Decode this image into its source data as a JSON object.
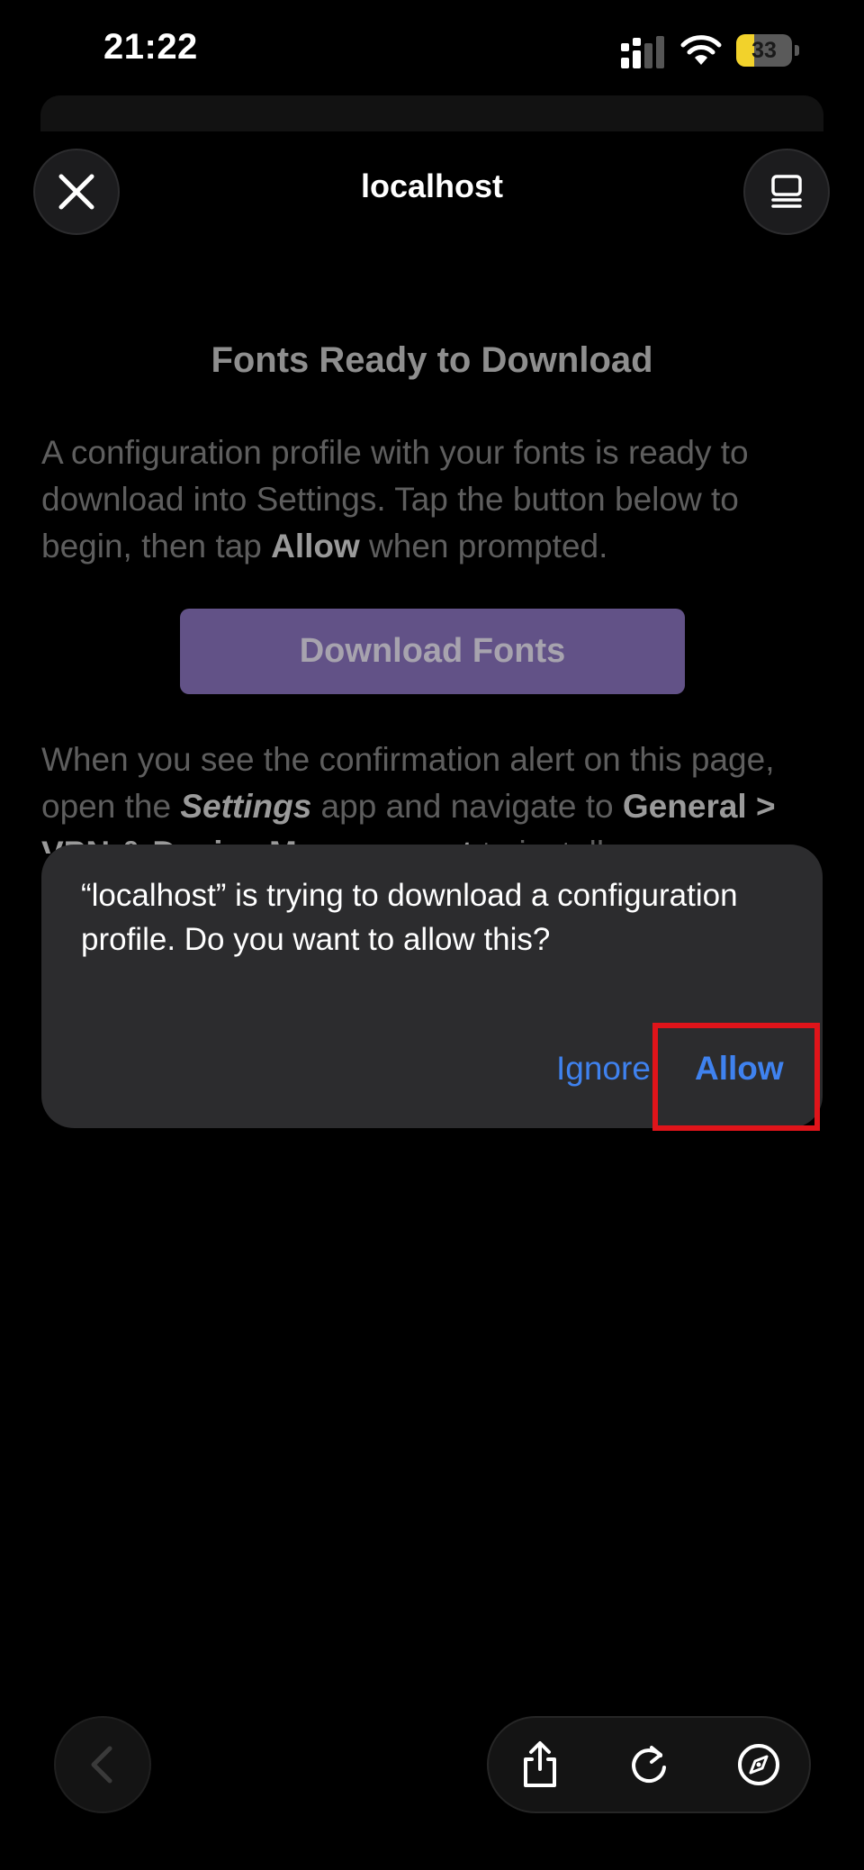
{
  "status_bar": {
    "time": "21:22",
    "battery_percent": "33",
    "battery_level": 0.33
  },
  "nav": {
    "title": "localhost"
  },
  "page": {
    "heading": "Fonts Ready to Download",
    "para1_a": "A configuration profile with your fonts is ready to download into Settings. Tap the button below to begin, then tap ",
    "para1_bold": "Allow",
    "para1_b": " when prompted.",
    "download_label": "Download Fonts",
    "para2_a": "When you see the confirmation alert on this page, open the ",
    "para2_italic": "Settings",
    "para2_b": " app and navigate to ",
    "para2_bold": "General > VPN & Device Management",
    "para2_c": " to install"
  },
  "alert": {
    "message": "“localhost” is trying to download a configuration profile. Do you want to allow this?",
    "ignore_label": "Ignore",
    "allow_label": "Allow"
  },
  "colors": {
    "accent": "#3f82ef",
    "highlight": "#e0141a",
    "button": "#625287"
  }
}
